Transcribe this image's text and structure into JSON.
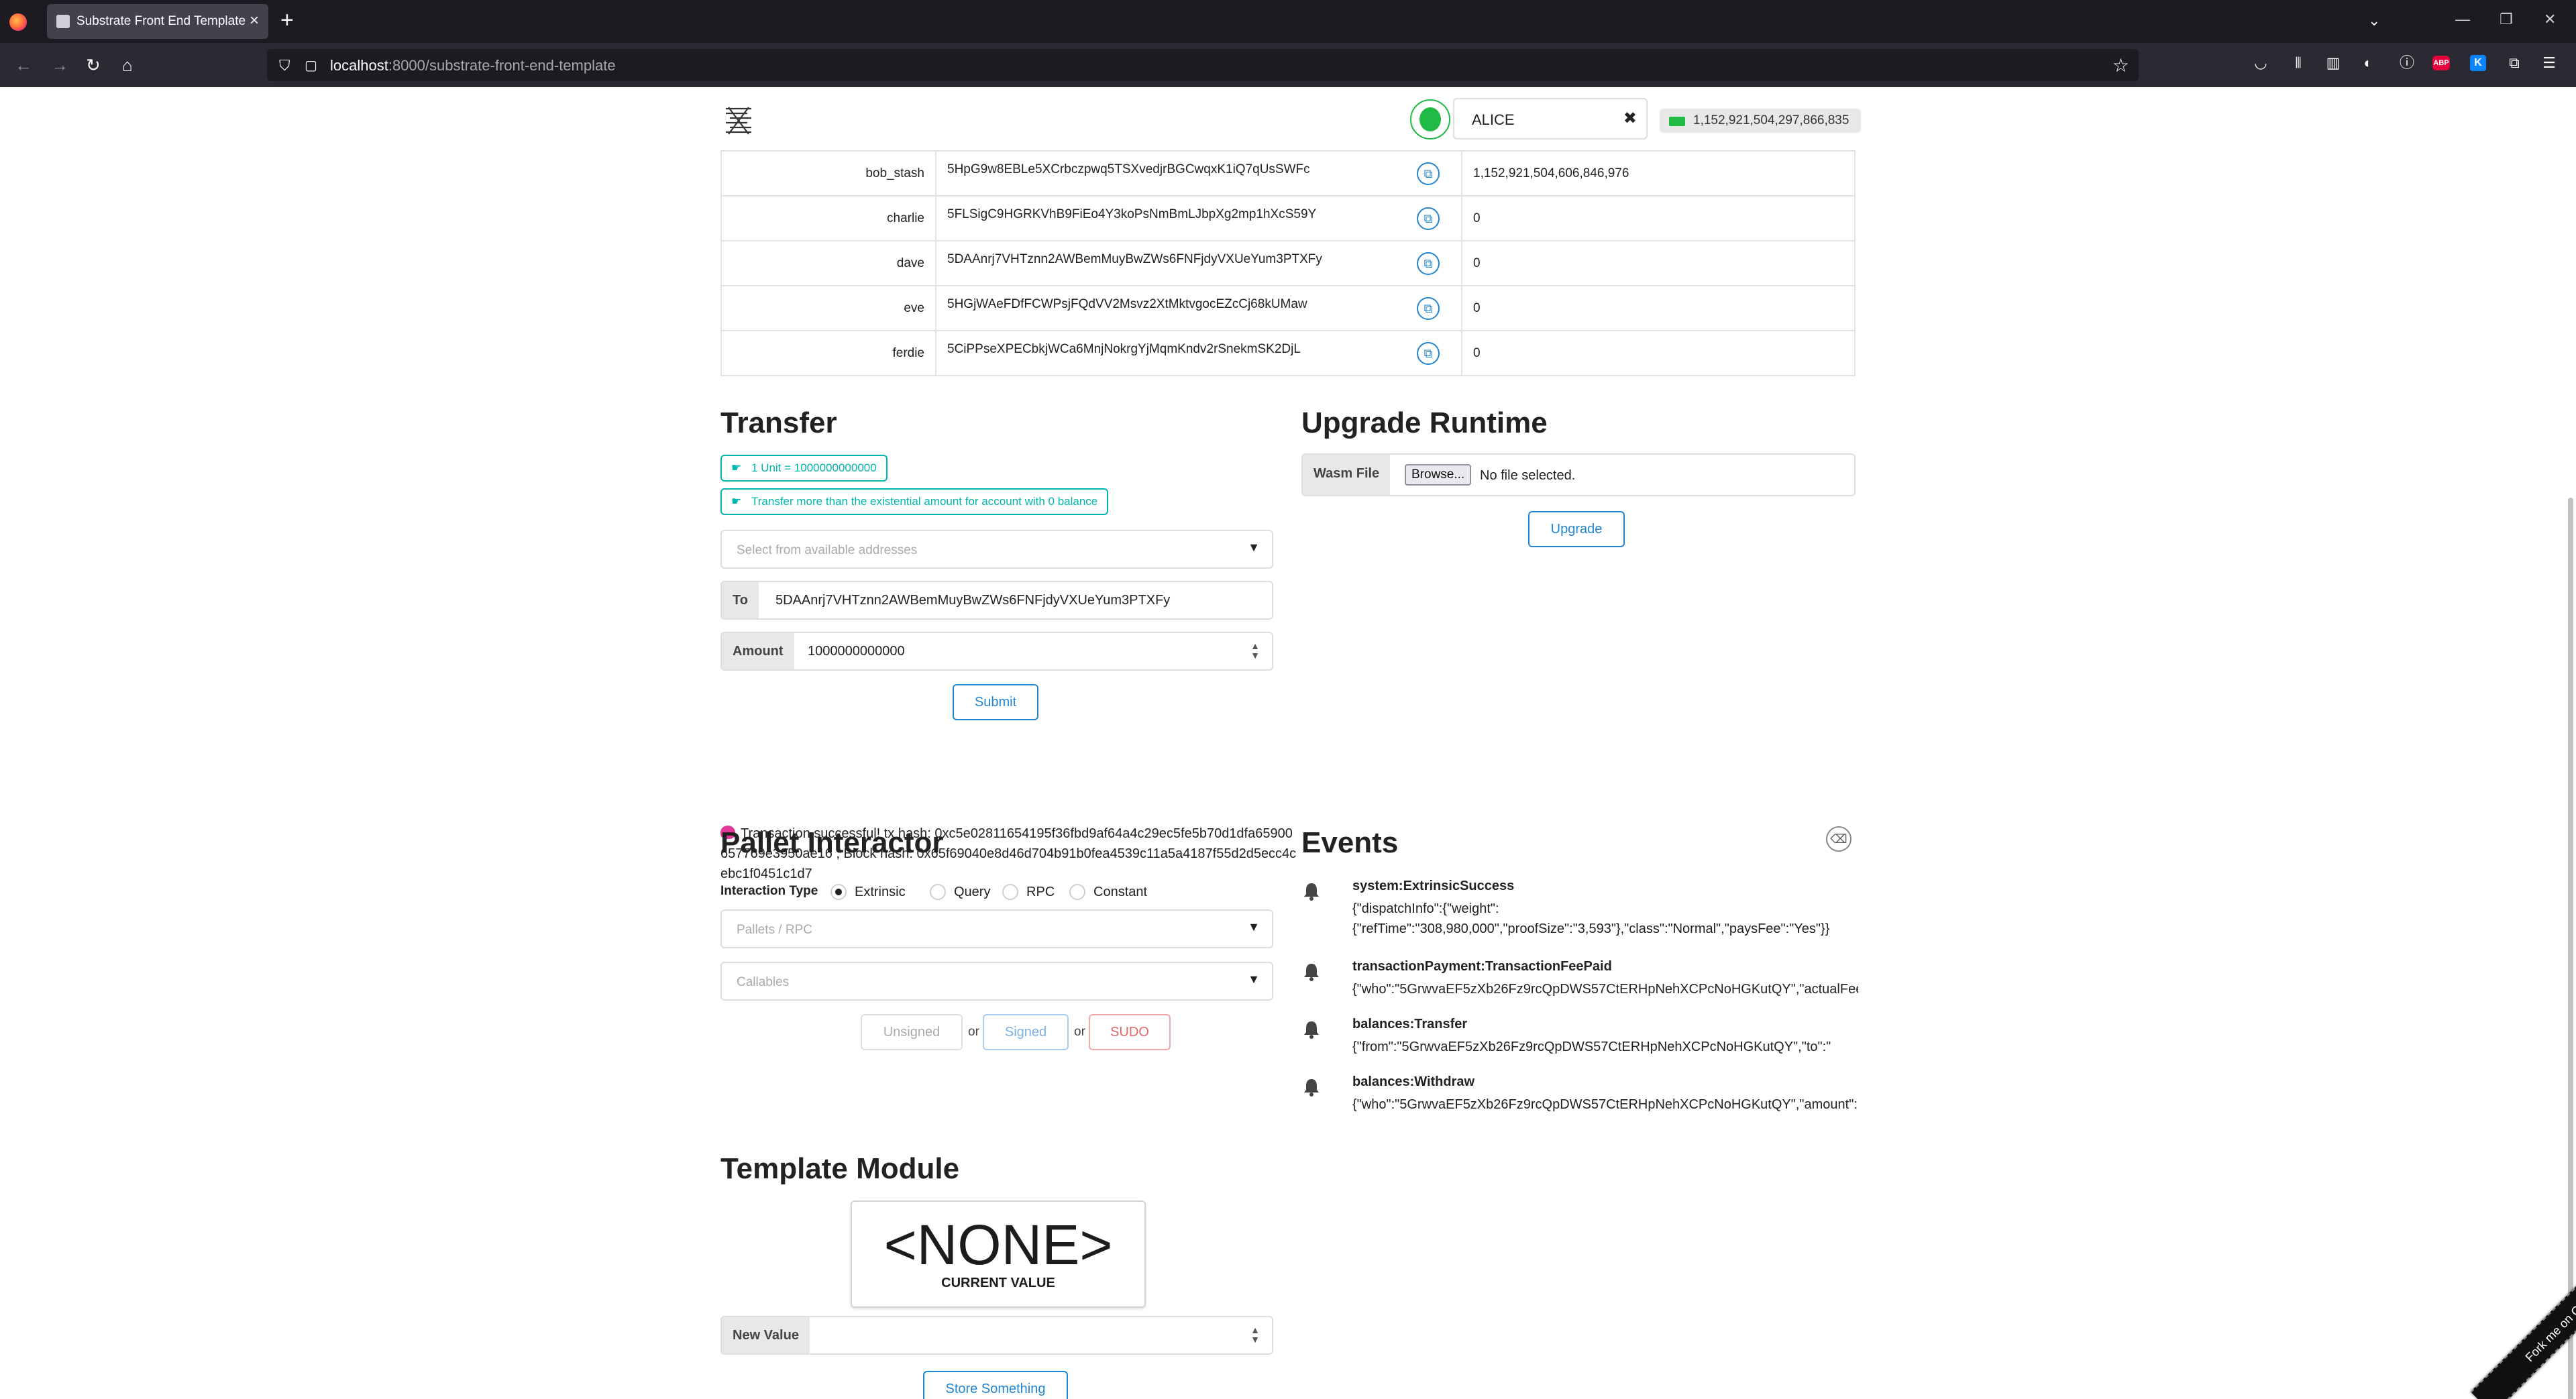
{
  "browser": {
    "tab_title": "Substrate Front End Template",
    "url_host": "localhost",
    "url_rest": ":8000/substrate-front-end-template"
  },
  "header": {
    "account_name": "ALICE",
    "balance": "1,152,921,504,297,866,835"
  },
  "accounts": [
    {
      "name": "bob_stash",
      "address": "5HpG9w8EBLe5XCrbczpwq5TSXvedjrBGCwqxK1iQ7qUsSWFc",
      "balance": "1,152,921,504,606,846,976"
    },
    {
      "name": "charlie",
      "address": "5FLSigC9HGRKVhB9FiEo4Y3koPsNmBmLJbpXg2mp1hXcS59Y",
      "balance": "0"
    },
    {
      "name": "dave",
      "address": "5DAAnrj7VHTznn2AWBemMuyBwZWs6FNFjdyVXUeYum3PTXFy",
      "balance": "0"
    },
    {
      "name": "eve",
      "address": "5HGjWAeFDfFCWPsjFQdVV2Msvz2XtMktvgocEZcCj68kUMaw",
      "balance": "0"
    },
    {
      "name": "ferdie",
      "address": "5CiPPseXPECbkjWCa6MnjNokrgYjMqmKndv2rSnekmSK2DjL",
      "balance": "0"
    }
  ],
  "transfer": {
    "title": "Transfer",
    "unit_label": "1 Unit = 1000000000000",
    "existential_label": "Transfer more than the existential amount for account with 0 balance",
    "address_placeholder": "Select from available addresses",
    "to_label": "To",
    "to_value": "5DAAnrj7VHTznn2AWBemMuyBwZWs6FNFjdyVXUeYum3PTXFy",
    "amount_label": "Amount",
    "amount_value": "1000000000000",
    "submit_label": "Submit",
    "status": "Transaction successful! tx hash: 0xc5e02811654195f36fbd9af64a4c29ec5fe5b70d1dfa65900657769e3950ae16 , Block hash: 0x65f69040e8d46d704b91b0fea4539c11a5a4187f55d2d5ecc4cebc1f0451c1d7"
  },
  "upgrade": {
    "title": "Upgrade Runtime",
    "wasm_label": "Wasm File",
    "browse_label": "Browse...",
    "file_status": "No file selected.",
    "button_label": "Upgrade"
  },
  "pallet": {
    "title": "Pallet Interactor",
    "interaction_label": "Interaction Type",
    "options": [
      "Extrinsic",
      "Query",
      "RPC",
      "Constant"
    ],
    "selected": "Extrinsic",
    "pallets_placeholder": "Pallets / RPC",
    "callables_placeholder": "Callables",
    "unsigned_label": "Unsigned",
    "signed_label": "Signed",
    "sudo_label": "SUDO",
    "or_label": "or"
  },
  "events": {
    "title": "Events",
    "items": [
      {
        "name": "system:ExtrinsicSuccess",
        "data": "{\"dispatchInfo\":{\"weight\":{\"refTime\":\"308,980,000\",\"proofSize\":\"3,593\"},\"class\":\"Normal\",\"paysFee\":\"Yes\"}}"
      },
      {
        "name": "transactionPayment:TransactionFeePaid",
        "data": "{\"who\":\"5GrwvaEF5zXb26Fz9rcQpDWS57CtERHpNehXCPcNoHGKutQY\",\"actualFee\":"
      },
      {
        "name": "balances:Transfer",
        "data": "{\"from\":\"5GrwvaEF5zXb26Fz9rcQpDWS57CtERHpNehXCPcNoHGKutQY\",\"to\":\""
      },
      {
        "name": "balances:Withdraw",
        "data": "{\"who\":\"5GrwvaEF5zXb26Fz9rcQpDWS57CtERHpNehXCPcNoHGKutQY\",\"amount\":"
      }
    ]
  },
  "template": {
    "title": "Template Module",
    "current_value": "<NONE>",
    "current_value_caption": "CURRENT VALUE",
    "new_value_label": "New Value",
    "store_button": "Store Something"
  },
  "ribbon": {
    "label": "Fork me on GitHub"
  },
  "colors": {
    "teal": "#00b5ad",
    "blue": "#2185d0",
    "green": "#21ba45",
    "red": "#db2828",
    "pink": "#e03997"
  }
}
